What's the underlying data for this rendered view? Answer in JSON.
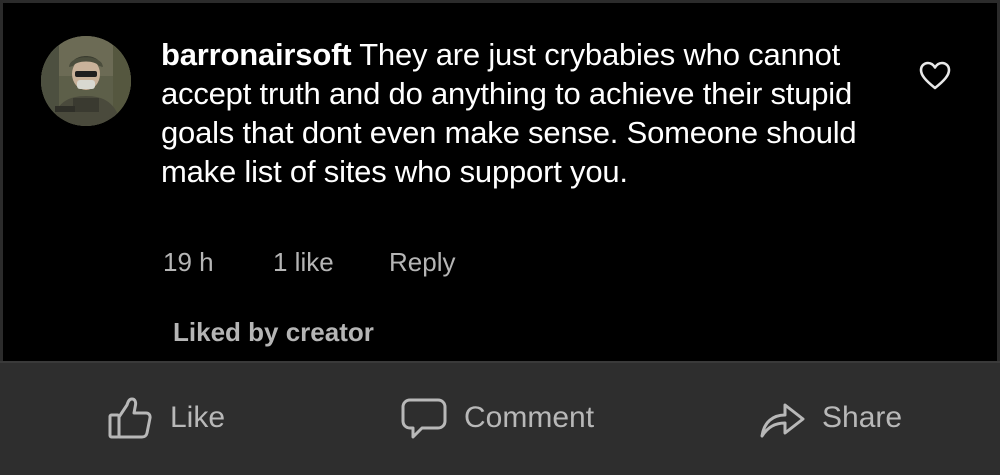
{
  "comment": {
    "username": "barronairsoft",
    "text": "They are just crybabies who cannot accept truth and do anything to achieve their stupid goals that dont even make sense. Someone should make list of sites who support you.",
    "time": "19 h",
    "likes": "1 like",
    "reply_label": "Reply",
    "liked_by": "Liked by creator",
    "icons": {
      "avatar": "user-avatar-photo",
      "like": "heart-icon"
    }
  },
  "actions": [
    {
      "label": "Like",
      "icon": "thumbs-up-icon"
    },
    {
      "label": "Comment",
      "icon": "speech-bubble-icon"
    },
    {
      "label": "Share",
      "icon": "share-arrow-icon"
    }
  ],
  "colors": {
    "comment_background": "#000000",
    "action_bar_background": "#2e2e2e",
    "text_primary": "#ffffff",
    "text_secondary": "#b5b5b5"
  }
}
